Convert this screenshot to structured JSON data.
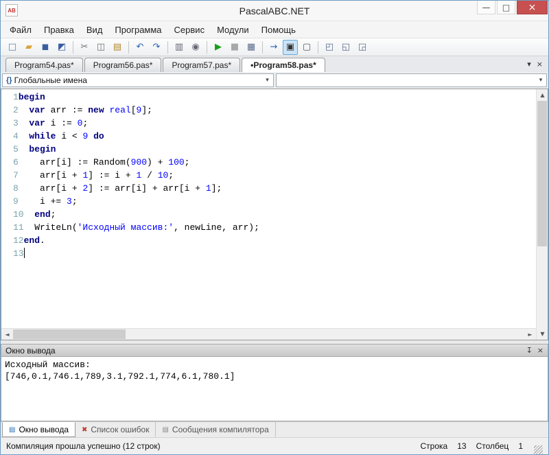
{
  "window": {
    "title": "PascalABC.NET",
    "app_icon_text": "AB",
    "minimize_glyph": "—",
    "maximize_glyph": "□",
    "close_glyph": "×"
  },
  "menu": {
    "items": [
      "Файл",
      "Правка",
      "Вид",
      "Программа",
      "Сервис",
      "Модули",
      "Помощь"
    ]
  },
  "toolbar": {
    "items": [
      {
        "name": "new-file-icon",
        "glyph": "□",
        "color": "#5b7fae"
      },
      {
        "name": "open-icon",
        "glyph": "▰",
        "color": "#d9a43b"
      },
      {
        "name": "save-icon",
        "glyph": "◼",
        "color": "#3a5fa0"
      },
      {
        "name": "save-all-icon",
        "glyph": "◩",
        "color": "#3a5fa0"
      },
      {
        "sep": true
      },
      {
        "name": "cut-icon",
        "glyph": "✂",
        "color": "#707070"
      },
      {
        "name": "copy-icon",
        "glyph": "◫",
        "color": "#707070"
      },
      {
        "name": "paste-icon",
        "glyph": "▤",
        "color": "#b5892e"
      },
      {
        "sep": true
      },
      {
        "name": "undo-icon",
        "glyph": "↶",
        "color": "#2b63b0"
      },
      {
        "name": "redo-icon",
        "glyph": "↷",
        "color": "#2b63b0"
      },
      {
        "sep": true
      },
      {
        "name": "print-icon",
        "glyph": "▥",
        "color": "#666677"
      },
      {
        "name": "search-icon",
        "glyph": "◉",
        "color": "#666677"
      },
      {
        "sep": true
      },
      {
        "name": "run-icon",
        "glyph": "▶",
        "color": "#18a018"
      },
      {
        "name": "stop-icon",
        "glyph": "■",
        "color": "#a8a8a8"
      },
      {
        "name": "compile-icon",
        "glyph": "▦",
        "color": "#5a6b8c"
      },
      {
        "sep": true
      },
      {
        "name": "step-icon",
        "glyph": "→",
        "color": "#2b63b0"
      },
      {
        "name": "output-window-toggle-icon",
        "glyph": "▣",
        "color": "#333333",
        "pressed": true
      },
      {
        "name": "console-icon",
        "glyph": "▢",
        "color": "#555555"
      },
      {
        "sep": true
      },
      {
        "name": "window-code-icon",
        "glyph": "◰",
        "color": "#5a6b8c"
      },
      {
        "name": "window-design-icon",
        "glyph": "◱",
        "color": "#5a6b8c"
      },
      {
        "name": "window-layout-icon",
        "glyph": "◲",
        "color": "#5a6b8c"
      }
    ]
  },
  "tabs": {
    "chevron_glyph": "▾",
    "close_glyph": "×",
    "items": [
      {
        "label": "Program54.pas*",
        "active": false
      },
      {
        "label": "Program56.pas*",
        "active": false
      },
      {
        "label": "Program57.pas*",
        "active": false
      },
      {
        "label": "•Program58.pas*",
        "active": true
      }
    ]
  },
  "navigation": {
    "scope_icon": "{}",
    "scope_value": "Глобальные имена",
    "member_value": "",
    "arrow_glyph": "▾"
  },
  "editor": {
    "lines": [
      {
        "n": "1",
        "t": [
          [
            "begin",
            "kw"
          ]
        ]
      },
      {
        "n": "2",
        "t": [
          [
            "  ",
            "pl"
          ],
          [
            "var",
            "kw"
          ],
          [
            " arr := ",
            "pl"
          ],
          [
            "new",
            "kw"
          ],
          [
            " ",
            "pl"
          ],
          [
            "real",
            "typ"
          ],
          [
            "[",
            "pl"
          ],
          [
            "9",
            "num"
          ],
          [
            "];",
            "pl"
          ]
        ]
      },
      {
        "n": "3",
        "t": [
          [
            "  ",
            "pl"
          ],
          [
            "var",
            "kw"
          ],
          [
            " i := ",
            "pl"
          ],
          [
            "0",
            "num"
          ],
          [
            ";",
            "pl"
          ]
        ]
      },
      {
        "n": "4",
        "t": [
          [
            "  ",
            "pl"
          ],
          [
            "while",
            "kw"
          ],
          [
            " i < ",
            "pl"
          ],
          [
            "9",
            "num"
          ],
          [
            " ",
            "pl"
          ],
          [
            "do",
            "kw"
          ]
        ]
      },
      {
        "n": "5",
        "t": [
          [
            "  ",
            "pl"
          ],
          [
            "begin",
            "kw"
          ]
        ]
      },
      {
        "n": "6",
        "t": [
          [
            "    arr[i] := Random(",
            "pl"
          ],
          [
            "900",
            "num"
          ],
          [
            ") + ",
            "pl"
          ],
          [
            "100",
            "num"
          ],
          [
            ";",
            "pl"
          ]
        ]
      },
      {
        "n": "7",
        "t": [
          [
            "    arr[i + ",
            "pl"
          ],
          [
            "1",
            "num"
          ],
          [
            "] := i + ",
            "pl"
          ],
          [
            "1",
            "num"
          ],
          [
            " / ",
            "pl"
          ],
          [
            "10",
            "num"
          ],
          [
            ";",
            "pl"
          ]
        ]
      },
      {
        "n": "8",
        "t": [
          [
            "    arr[i + ",
            "pl"
          ],
          [
            "2",
            "num"
          ],
          [
            "] := arr[i] + arr[i + ",
            "pl"
          ],
          [
            "1",
            "num"
          ],
          [
            "];",
            "pl"
          ]
        ]
      },
      {
        "n": "9",
        "t": [
          [
            "    i += ",
            "pl"
          ],
          [
            "3",
            "num"
          ],
          [
            ";",
            "pl"
          ]
        ]
      },
      {
        "n": "10",
        "t": [
          [
            "  ",
            "pl"
          ],
          [
            "end",
            "kw"
          ],
          [
            ";",
            "pl"
          ]
        ]
      },
      {
        "n": "11",
        "t": [
          [
            "  WriteLn(",
            "pl"
          ],
          [
            "'Исходный массив:'",
            "str"
          ],
          [
            ", newLine, arr);",
            "pl"
          ]
        ]
      },
      {
        "n": "12",
        "t": [
          [
            "end",
            "kw"
          ],
          [
            ".",
            "pl"
          ]
        ]
      },
      {
        "n": "13",
        "t": [],
        "caret": true
      }
    ]
  },
  "scrollbars": {
    "up": "▲",
    "down": "▼",
    "left": "◄",
    "right": "►"
  },
  "output": {
    "title": "Окно вывода",
    "pin_glyph": "↧",
    "close_glyph": "×",
    "lines": [
      "Исходный массив:",
      "[746,0.1,746.1,789,3.1,792.1,774,6.1,780.1]"
    ]
  },
  "bottom_tabs": {
    "items": [
      {
        "label": "Окно вывода",
        "name": "bottom-tab-output",
        "icon_name": "output-window-icon",
        "icon_glyph": "▤",
        "icon_color": "#2b6cb0",
        "active": true
      },
      {
        "label": "Список ошибок",
        "name": "bottom-tab-errors",
        "icon_name": "error-list-icon",
        "icon_glyph": "✖",
        "icon_color": "#c0392b",
        "active": false
      },
      {
        "label": "Сообщения компилятора",
        "name": "bottom-tab-compiler-messages",
        "icon_name": "compiler-messages-icon",
        "icon_glyph": "▤",
        "icon_color": "#888888",
        "active": false
      }
    ]
  },
  "status": {
    "message": "Компиляция прошла успешно (12 строк)",
    "line_label": "Строка",
    "line_value": "13",
    "col_label": "Столбец",
    "col_value": "1"
  }
}
